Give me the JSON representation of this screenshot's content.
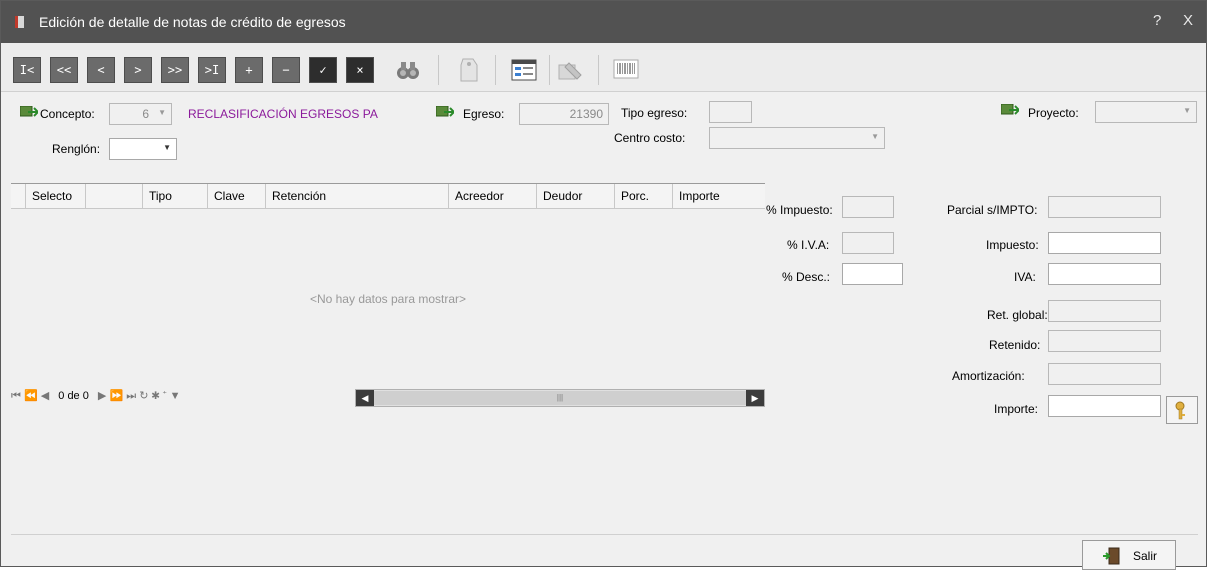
{
  "window": {
    "title": "Edición de detalle de notas de crédito de egresos",
    "help_glyph": "?",
    "close_glyph": "X"
  },
  "toolbar": {
    "nav_buttons": [
      {
        "label": "I<",
        "icon": "first-record-icon"
      },
      {
        "label": "<<",
        "icon": "prev-page-icon"
      },
      {
        "label": "<",
        "icon": "prev-record-icon"
      },
      {
        "label": ">",
        "icon": "next-record-icon"
      },
      {
        "label": ">>",
        "icon": "next-page-icon"
      },
      {
        "label": ">I",
        "icon": "last-record-icon"
      },
      {
        "label": "+",
        "icon": "add-icon"
      },
      {
        "label": "−",
        "icon": "remove-icon"
      },
      {
        "label": "✓",
        "icon": "confirm-icon"
      },
      {
        "label": "×",
        "icon": "cancel-icon"
      }
    ],
    "tool_icons": [
      "binoculars-icon",
      "tag-icon",
      "form-icon",
      "edit-list-icon",
      "barcode-icon"
    ]
  },
  "header_fields": {
    "concepto_label": "Concepto:",
    "concepto_value": "6",
    "concepto_desc": "RECLASIFICACIÓN EGRESOS PA",
    "egreso_label": "Egreso:",
    "egreso_value": "21390",
    "tipo_egreso_label": "Tipo egreso:",
    "centro_costo_label": "Centro costo:",
    "proyecto_label": "Proyecto:",
    "renglon_label": "Renglón:"
  },
  "grid": {
    "columns": [
      "Selecto",
      "",
      "Tipo",
      "Clave",
      "Retención",
      "Acreedor",
      "Deudor",
      "Porc.",
      "Importe"
    ],
    "empty_text": "<No hay datos para mostrar>",
    "nav_counter": "0 de 0"
  },
  "right_fields": {
    "impuesto_pct": "% Impuesto:",
    "iva_pct": "% I.V.A:",
    "desc_pct": "% Desc.:",
    "parcial": "Parcial s/IMPTO:",
    "impuesto": "Impuesto:",
    "iva": "IVA:",
    "ret_global": "Ret. global:",
    "retenido": "Retenido:",
    "amortizacion": "Amortización:",
    "importe": "Importe:"
  },
  "footer": {
    "exit_label": "Salir"
  },
  "colors": {
    "titlebar": "#525252",
    "nav_button": "#6b6b6b",
    "concept_desc": "#8b1a9b"
  }
}
